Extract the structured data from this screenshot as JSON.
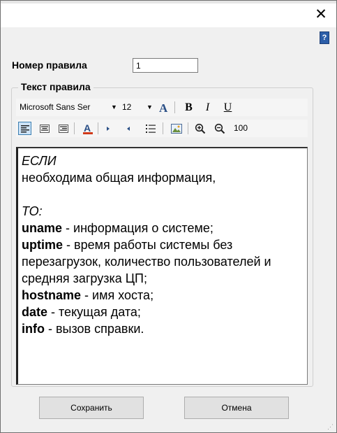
{
  "window": {
    "close_glyph": "✕",
    "help_glyph": "?"
  },
  "form": {
    "rule_number_label": "Номер правила",
    "rule_number_value": "1",
    "rule_text_label": "Текст правила"
  },
  "toolbar": {
    "font_name": "Microsoft Sans Ser",
    "font_size": "12",
    "bold": "B",
    "italic": "I",
    "underline": "U",
    "font_color": "A",
    "zoom": "100"
  },
  "editor": {
    "lines": [
      {
        "text": "ЕСЛИ"
      },
      {
        "text": "необходима общая информация,"
      },
      {
        "text": ""
      },
      {
        "text": "ТО:"
      },
      {
        "cmd": "uname",
        "text": " - информация о системе;"
      },
      {
        "cmd": "uptime",
        "text": " - время работы системы без"
      },
      {
        "text": "перезагрузок, количество пользователей и"
      },
      {
        "text": "средняя загрузка ЦП;"
      },
      {
        "cmd": "hostname",
        "text": " - имя хоста;"
      },
      {
        "cmd": "date",
        "text": " - текущая дата;"
      },
      {
        "cmd": "info",
        "text": " - вызов справки."
      }
    ]
  },
  "buttons": {
    "save": "Сохранить",
    "cancel": "Отмена"
  },
  "colors": {
    "accent": "#2c5ea8",
    "font_color_bar": "#d03a1a"
  }
}
